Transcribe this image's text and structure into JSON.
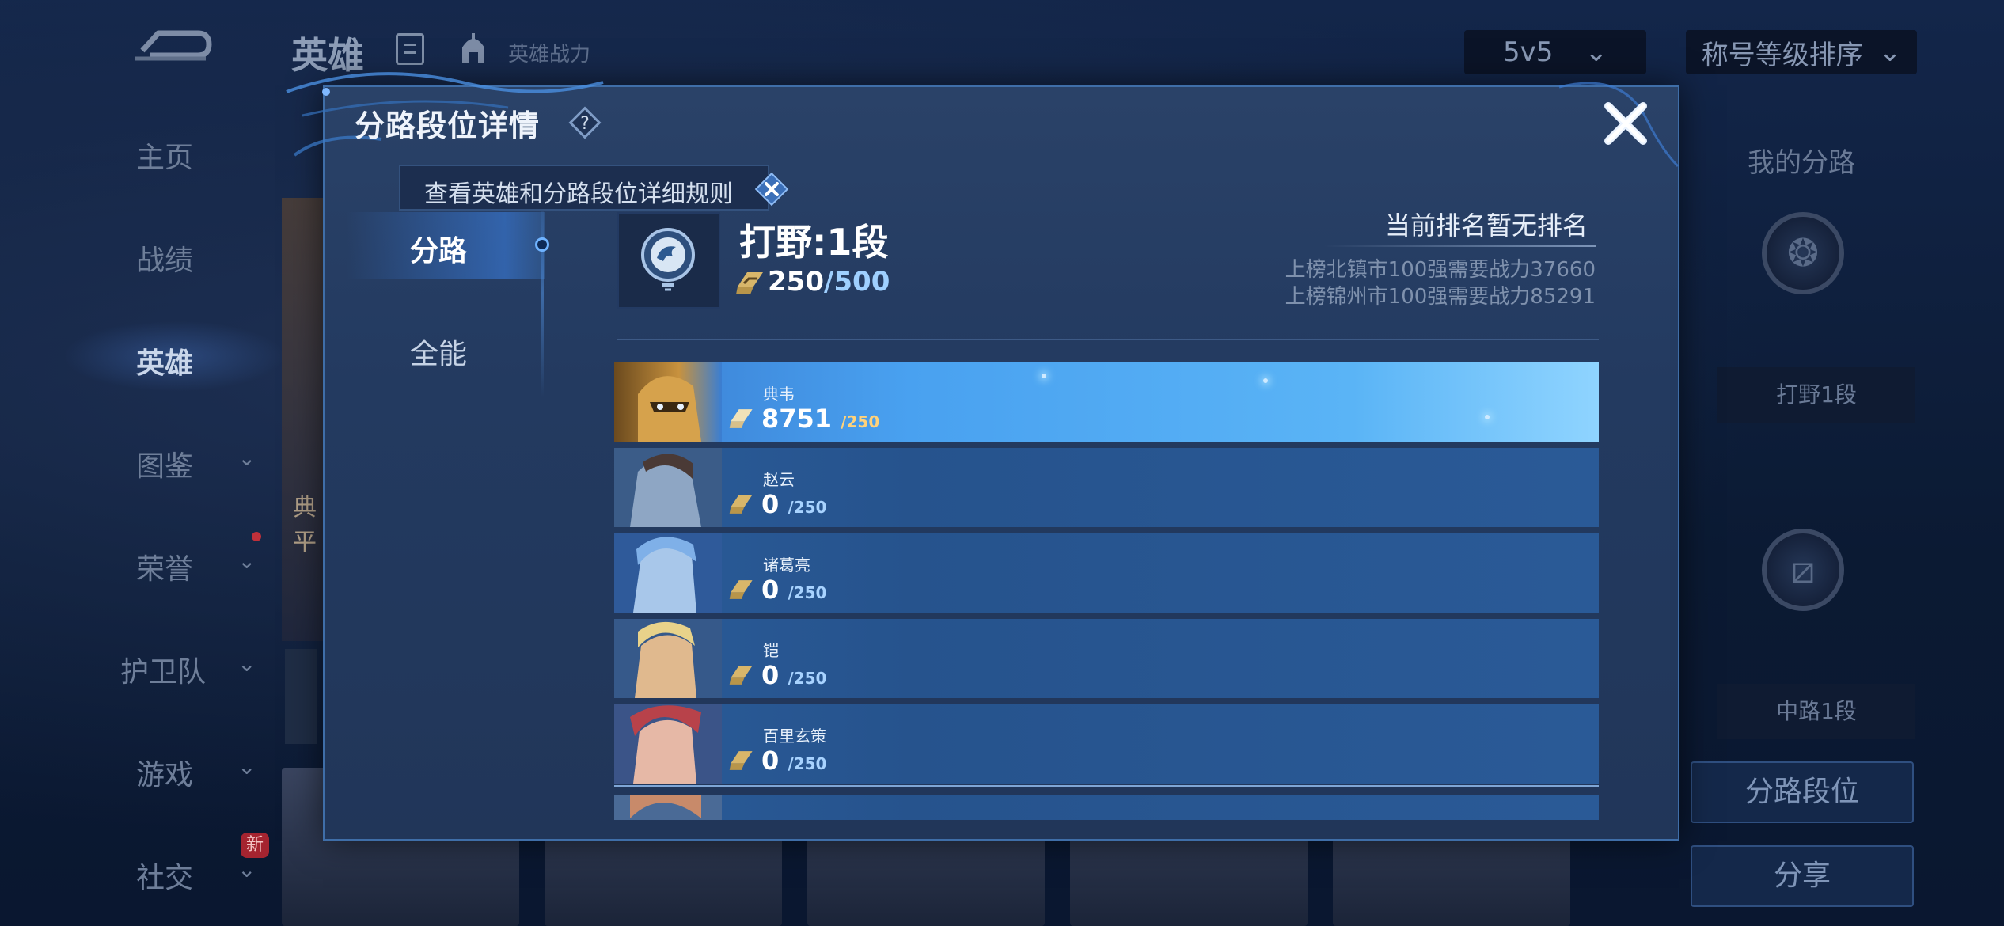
{
  "topbar": {
    "title": "英雄",
    "power_label": "英雄战力",
    "mode_select": "5v5",
    "sort_select": "称号等级排序"
  },
  "sidenav": {
    "items": [
      {
        "label": "主页"
      },
      {
        "label": "战绩"
      },
      {
        "label": "英雄"
      },
      {
        "label": "图鉴"
      },
      {
        "label": "荣誉"
      },
      {
        "label": "护卫队"
      },
      {
        "label": "游戏"
      },
      {
        "label": "社交"
      }
    ],
    "new_badge": "新"
  },
  "background_hero": {
    "name_fragment_1": "典",
    "name_fragment_2": "平"
  },
  "right_panel": {
    "title": "我的分路",
    "lane1": "打野1段",
    "lane2": "中路1段",
    "btn_lane_rank": "分路段位",
    "btn_share": "分享"
  },
  "dialog": {
    "title": "分路段位详情",
    "tooltip": "查看英雄和分路段位详细规则",
    "tabs": [
      {
        "label": "分路"
      },
      {
        "label": "全能"
      }
    ],
    "lane": {
      "title": "打野:1段",
      "points": "250",
      "points_max": "/500"
    },
    "rank_status": "当前排名暂无排名",
    "rank_req_1": "上榜北镇市100强需要战力37660",
    "rank_req_2": "上榜锦州市100强需要战力85291",
    "heroes": [
      {
        "name": "典韦",
        "points": "8751",
        "max": "/250"
      },
      {
        "name": "赵云",
        "points": "0",
        "max": "/250"
      },
      {
        "name": "诸葛亮",
        "points": "0",
        "max": "/250"
      },
      {
        "name": "铠",
        "points": "0",
        "max": "/250"
      },
      {
        "name": "百里玄策",
        "points": "0",
        "max": "/250"
      }
    ]
  },
  "colors": {
    "accent": "#4aa4f2",
    "gold": "#d8b66a"
  }
}
